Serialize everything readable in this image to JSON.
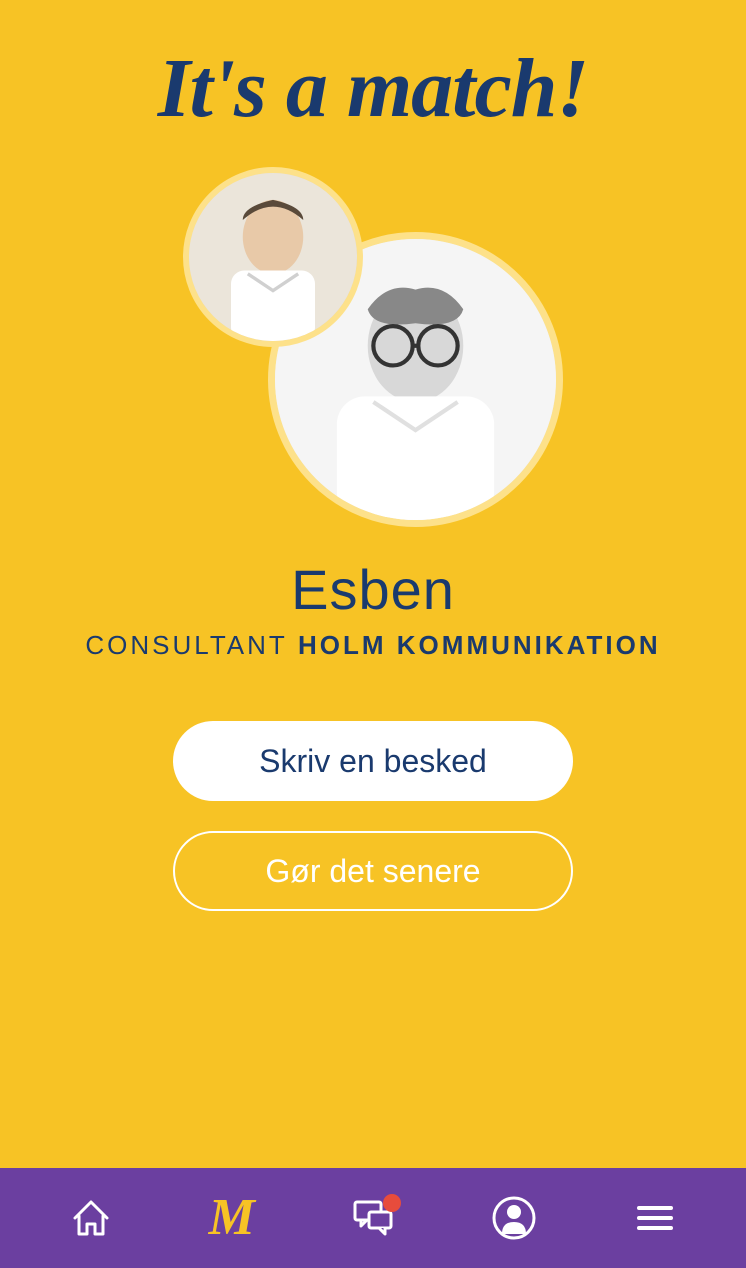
{
  "headline": "It's a match!",
  "match": {
    "name": "Esben",
    "role": "CONSULTANT",
    "company": "HOLM KOMMUNIKATION"
  },
  "buttons": {
    "primary": "Skriv en besked",
    "secondary": "Gør det senere"
  },
  "nav": {
    "m_label": "M",
    "has_chat_notification": true
  },
  "colors": {
    "background": "#f7c325",
    "text_dark": "#1a3a6e",
    "navbar": "#6b3fa0",
    "accent": "#f7c325",
    "badge": "#e74c3c"
  }
}
